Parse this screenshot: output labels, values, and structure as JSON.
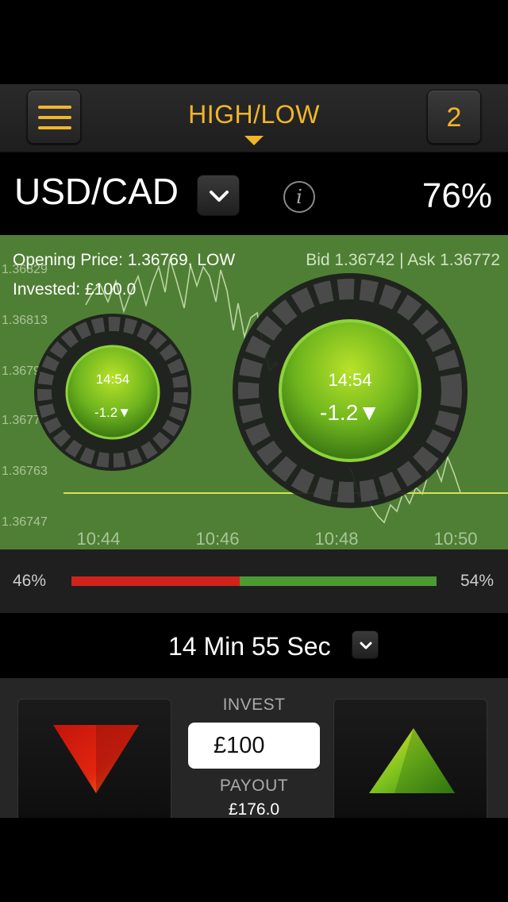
{
  "header": {
    "menu_icon": "hamburger-icon",
    "title": "HIGH/LOW",
    "title_caret_icon": "caret-down-icon",
    "open_trades_count": "2"
  },
  "asset": {
    "name": "USD/CAD",
    "dropdown_icon": "chevron-down-icon",
    "info_icon": "info-icon",
    "info_glyph": "i",
    "payout_percent": "76%"
  },
  "chart": {
    "opening_price": "Opening Price: 1.36769, LOW",
    "bid_ask": "Bid 1.36742 | Ask 1.36772",
    "invested": "Invested: £100.0",
    "y_ticks": [
      "1.36829",
      "1.36813",
      "1.36797",
      "1.36779",
      "1.36763",
      "1.36747"
    ],
    "x_ticks": [
      "10:44",
      "10:46",
      "10:48",
      "10:50"
    ],
    "accent_line_color": "#d4e25a",
    "timers": [
      {
        "time": "14:54",
        "value": "-1.2▼"
      },
      {
        "time": "14:54",
        "value": "-1.2▼"
      }
    ]
  },
  "sentiment": {
    "low_percent": "46%",
    "high_percent": "54%",
    "low_fraction": 0.46,
    "low_color": "#d0231b",
    "high_color": "#4c9a32"
  },
  "expiry": {
    "label": "14 Min 55 Sec",
    "dropdown_icon": "chevron-down-icon"
  },
  "trade": {
    "low_icon": "arrow-down-triangle-icon",
    "high_icon": "arrow-up-triangle-icon",
    "invest_label": "INVEST",
    "invest_value": "£100",
    "payout_label": "PAYOUT",
    "payout_value": "£176.0"
  },
  "colors": {
    "accent": "#f2b52a",
    "chart_bg": "#4f7f34"
  }
}
